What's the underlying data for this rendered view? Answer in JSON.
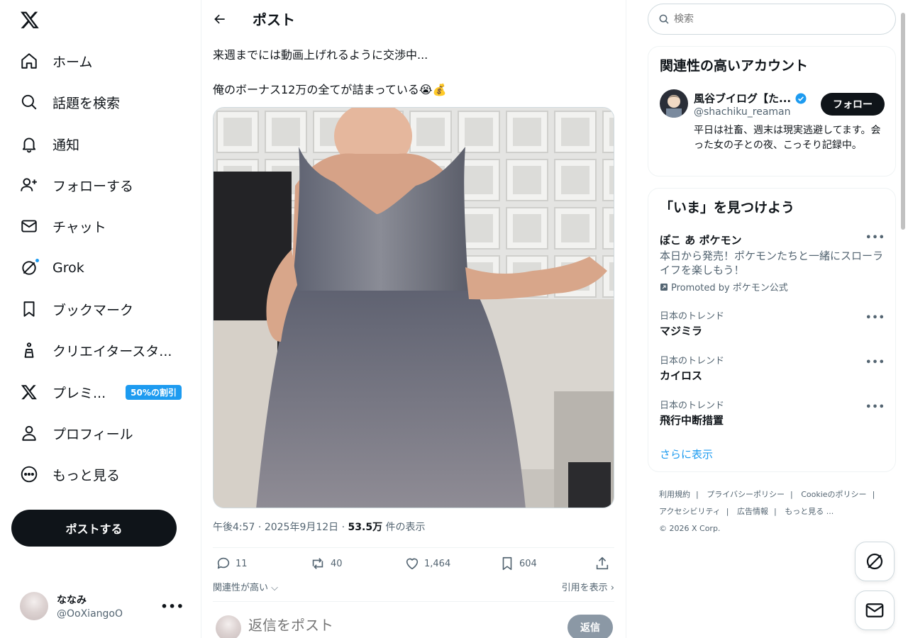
{
  "nav": {
    "items": [
      {
        "label": "ホーム",
        "icon": "home-icon"
      },
      {
        "label": "話題を検索",
        "icon": "search-icon"
      },
      {
        "label": "通知",
        "icon": "bell-icon"
      },
      {
        "label": "フォローする",
        "icon": "follow-icon"
      },
      {
        "label": "チャット",
        "icon": "mail-icon"
      },
      {
        "label": "Grok",
        "icon": "grok-icon"
      },
      {
        "label": "ブックマーク",
        "icon": "bookmark-icon"
      },
      {
        "label": "クリエイタースタ...",
        "icon": "creator-icon"
      },
      {
        "label": "プレミ...",
        "icon": "x-premium-icon",
        "badge": "50%の割引"
      },
      {
        "label": "プロフィール",
        "icon": "profile-icon"
      },
      {
        "label": "もっと見る",
        "icon": "more-icon"
      }
    ],
    "post_button": "ポストする"
  },
  "account": {
    "name": "ななみ",
    "handle": "@OoXiangoO",
    "more": "•••"
  },
  "header": {
    "title": "ポスト"
  },
  "tweet": {
    "line1": "来週までには動画上げれるように交渉中...",
    "line2": "俺のボーナス12万の全てが詰まっている😭💰",
    "time": "午後4:57",
    "date": "2025年9月12日",
    "views": "53.5万",
    "views_suffix": "件の表示",
    "replies": "11",
    "retweets": "40",
    "likes": "1,464",
    "bookmarks": "604"
  },
  "sort": {
    "label": "関連性が高い",
    "quotes": "引用を表示"
  },
  "reply": {
    "placeholder": "返信をポスト",
    "button": "返信"
  },
  "search": {
    "placeholder": "検索"
  },
  "relevant": {
    "title": "関連性の高いアカウント",
    "name": "風谷ブイログ【た...",
    "handle": "@shachiku_reaman",
    "follow": "フォロー",
    "bio": "平日は社畜、週末は現実逃避してます。会った女の子との夜、こっそり記録中。"
  },
  "discover": {
    "title": "「いま」を見つけよう",
    "promo": {
      "title": "ぽこ あ ポケモン",
      "text": "本日から発売！ポケモンたちと一緒にスローライフを楽しもう！",
      "by": "Promoted by ポケモン公式"
    },
    "trends": [
      {
        "context": "日本のトレンド",
        "name": "マジミラ"
      },
      {
        "context": "日本のトレンド",
        "name": "カイロス"
      },
      {
        "context": "日本のトレンド",
        "name": "飛行中断措置"
      }
    ],
    "more_icon": "•••",
    "show_more": "さらに表示"
  },
  "footer": {
    "links": [
      "利用規約",
      "プライバシーポリシー",
      "Cookieのポリシー",
      "アクセシビリティ",
      "広告情報",
      "もっと見る ..."
    ],
    "copyright": "© 2026 X Corp."
  },
  "colors": {
    "accent": "#1d9bf0",
    "text": "#0f1419",
    "secondary": "#536471"
  }
}
